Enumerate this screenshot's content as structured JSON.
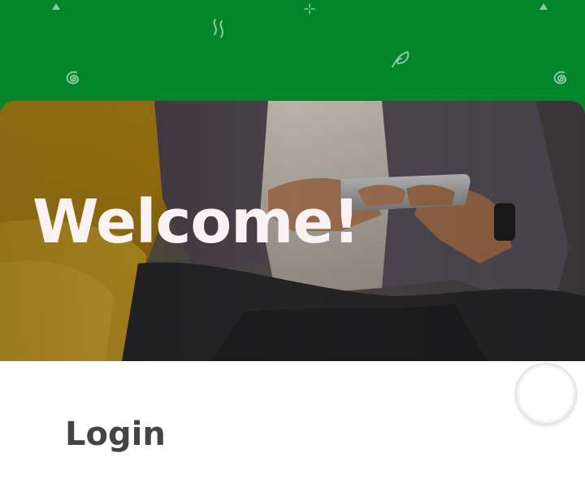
{
  "header": {
    "background_color": "#03862a",
    "decorations": [
      "triangle-icon",
      "squiggle-icon",
      "sparkle-icon",
      "spiral-icon",
      "leaf-icon",
      "spiral-icon",
      "triangle-icon"
    ]
  },
  "hero": {
    "title": "Welcome!",
    "title_color": "#fbf2f4",
    "image": "person-holding-phone-photo"
  },
  "login": {
    "title": "Login"
  },
  "fab": {
    "icon": "circle-button"
  }
}
